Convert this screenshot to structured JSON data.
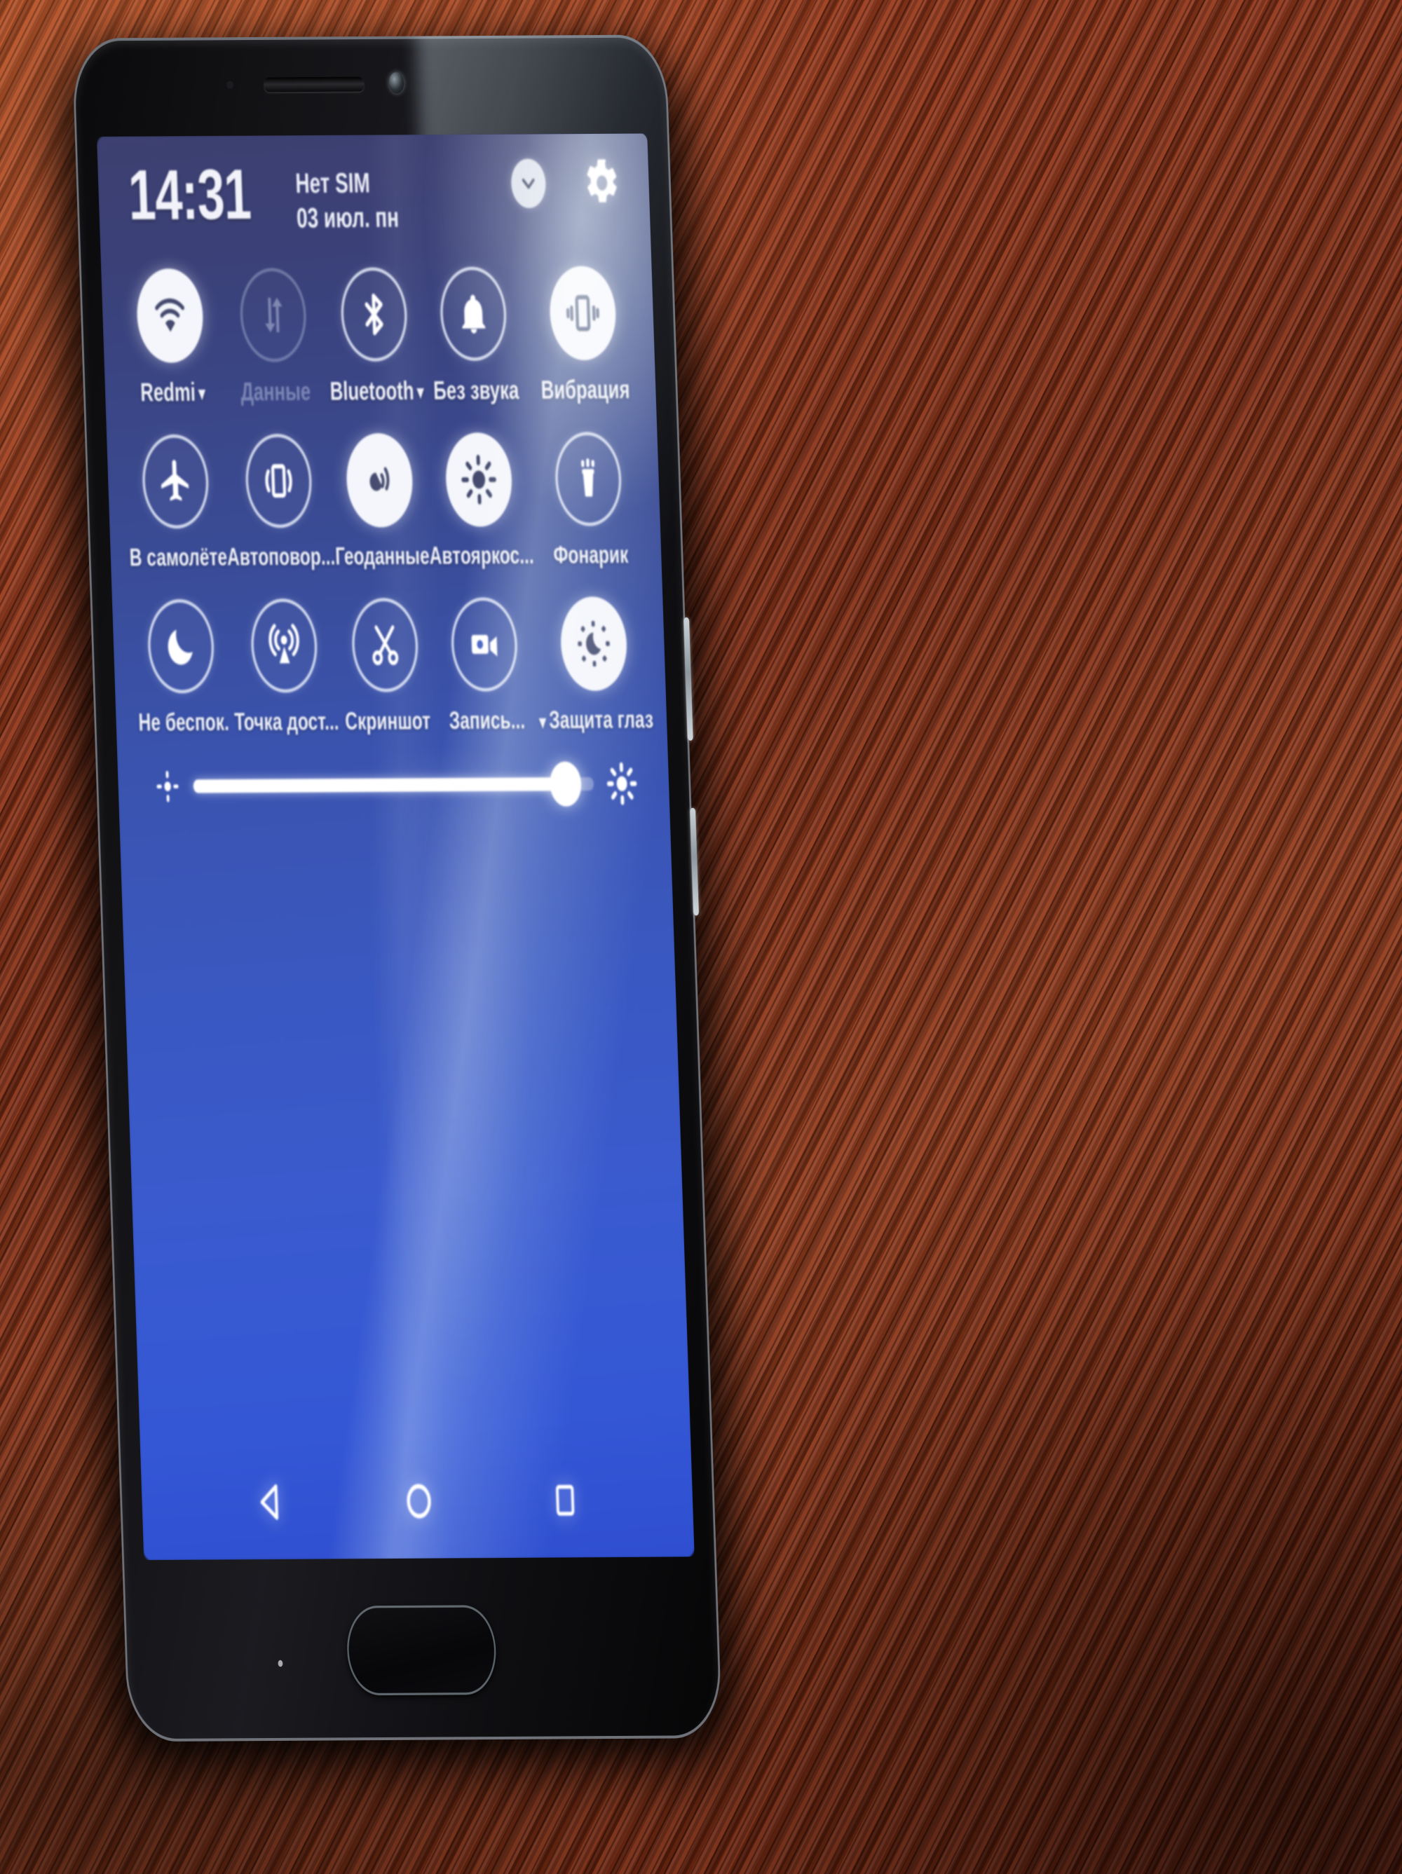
{
  "device": {
    "name": "Xiaomi Redmi smartphone",
    "surface": "wooden table",
    "accent_blue": "#3a58c0",
    "panel_top_color": "#3d4070",
    "wood_color": "#8f3a1c"
  },
  "status": {
    "clock": "14:31",
    "sim": "Нет SIM",
    "date": "03 июл. пн"
  },
  "header": {
    "collapse_icon": "chevron-down-icon",
    "settings_icon": "gear-icon"
  },
  "tiles": [
    {
      "id": "wifi",
      "label": "Redmi",
      "icon": "wifi-icon",
      "state": "on",
      "caret": "▾"
    },
    {
      "id": "mobile-data",
      "label": "Данные",
      "icon": "data-transfer-icon",
      "state": "dim",
      "caret": ""
    },
    {
      "id": "bluetooth",
      "label": "Bluetooth",
      "icon": "bluetooth-icon",
      "state": "off",
      "caret": "▾"
    },
    {
      "id": "silent",
      "label": "Без звука",
      "icon": "bell-icon",
      "state": "off",
      "caret": ""
    },
    {
      "id": "vibrate",
      "label": "Вибрация",
      "icon": "vibrate-icon",
      "state": "on",
      "caret": ""
    },
    {
      "id": "airplane",
      "label": "В самолёте",
      "icon": "airplane-icon",
      "state": "off",
      "caret": ""
    },
    {
      "id": "autorotate",
      "label": "Автоповор...",
      "icon": "auto-rotate-icon",
      "state": "off",
      "caret": ""
    },
    {
      "id": "location",
      "label": "Геоданные",
      "icon": "location-icon",
      "state": "on",
      "caret": ""
    },
    {
      "id": "autobright",
      "label": "Автояркос...",
      "icon": "sun-icon",
      "state": "on",
      "caret": ""
    },
    {
      "id": "flashlight",
      "label": "Фонарик",
      "icon": "flashlight-icon",
      "state": "off",
      "caret": ""
    },
    {
      "id": "dnd",
      "label": "Не беспок.",
      "icon": "moon-icon",
      "state": "off",
      "caret": ""
    },
    {
      "id": "hotspot",
      "label": "Точка дост...",
      "icon": "hotspot-icon",
      "state": "off",
      "caret": ""
    },
    {
      "id": "screenshot",
      "label": "Скриншот",
      "icon": "scissors-icon",
      "state": "off",
      "caret": ""
    },
    {
      "id": "screenrec",
      "label": "Запись...",
      "icon": "video-camera-icon",
      "state": "off",
      "caret": ""
    },
    {
      "id": "readmode",
      "label": "Защита глаз",
      "icon": "eye-comfort-icon",
      "state": "on",
      "caret_left": "▾"
    }
  ],
  "brightness": {
    "low_icon": "brightness-low-icon",
    "high_icon": "brightness-high-icon",
    "value_percent": 93
  },
  "navbar": {
    "back": "back-triangle-icon",
    "home": "home-circle-icon",
    "recents": "recents-square-icon"
  }
}
